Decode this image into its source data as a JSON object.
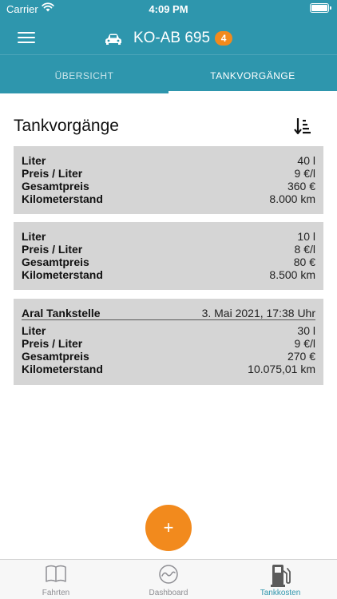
{
  "status_bar": {
    "carrier": "Carrier",
    "time": "4:09 PM"
  },
  "header": {
    "vehicle_plate": "KO-AB 695",
    "badge_count": "4",
    "color": "#2e96ad",
    "icons": {
      "menu": "hamburger-icon",
      "vehicle": "car-icon"
    }
  },
  "tabs": [
    {
      "label": "ÜBERSICHT",
      "active": false
    },
    {
      "label": "TANKVORGÄNGE",
      "active": true
    }
  ],
  "list": {
    "title": "Tankvorgänge",
    "sort_icon": "sort-descending-icon",
    "entries": [
      {
        "rows": [
          {
            "label": "Liter",
            "value": "40 l"
          },
          {
            "label": "Preis / Liter",
            "value": "9 €/l"
          },
          {
            "label": "Gesamtpreis",
            "value": "360 €"
          },
          {
            "label": "Kilometerstand",
            "value": "8.000 km"
          }
        ]
      },
      {
        "rows": [
          {
            "label": "Liter",
            "value": "10 l"
          },
          {
            "label": "Preis / Liter",
            "value": "8 €/l"
          },
          {
            "label": "Gesamtpreis",
            "value": "80 €"
          },
          {
            "label": "Kilometerstand",
            "value": "8.500 km"
          }
        ]
      },
      {
        "station": "Aral Tankstelle",
        "date": "3. Mai 2021, 17:38 Uhr",
        "rows": [
          {
            "label": "Liter",
            "value": "30 l"
          },
          {
            "label": "Preis / Liter",
            "value": "9 €/l"
          },
          {
            "label": "Gesamtpreis",
            "value": "270 €"
          },
          {
            "label": "Kilometerstand",
            "value": "10.075,01 km"
          }
        ]
      }
    ]
  },
  "fab": {
    "label": "+",
    "color": "#f28a1d"
  },
  "bottom_nav": [
    {
      "label": "Fahrten",
      "icon": "book-icon",
      "active": false
    },
    {
      "label": "Dashboard",
      "icon": "gauge-icon",
      "active": false
    },
    {
      "label": "Tankkosten",
      "icon": "fuel-pump-icon",
      "active": true
    }
  ]
}
